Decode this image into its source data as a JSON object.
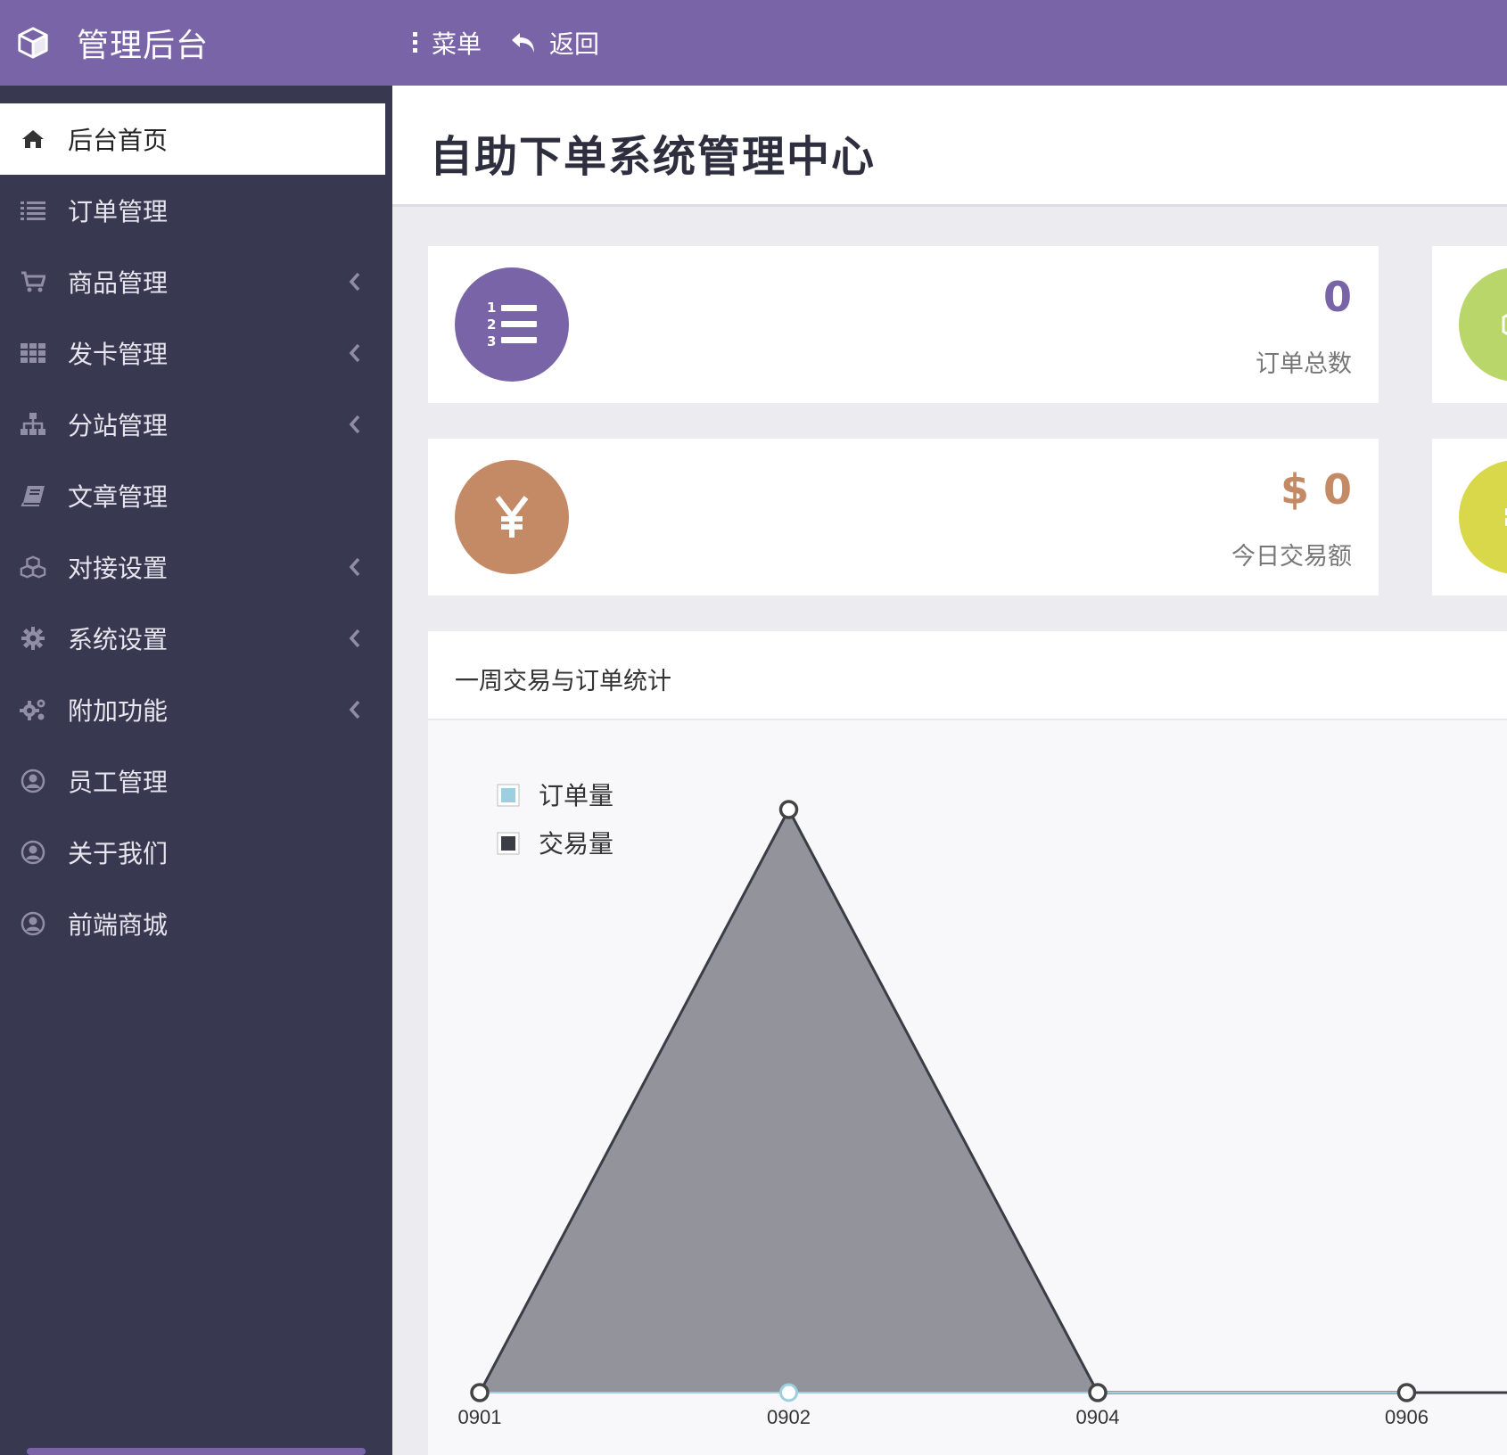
{
  "header": {
    "brand_title": "管理后台",
    "brand_icon": "cube-icon",
    "menu_label": "菜单",
    "back_label": "返回"
  },
  "sidebar": {
    "items": [
      {
        "label": "后台首页",
        "icon": "home-icon",
        "active": true,
        "has_submenu": false
      },
      {
        "label": "订单管理",
        "icon": "list-icon",
        "active": false,
        "has_submenu": false
      },
      {
        "label": "商品管理",
        "icon": "cart-icon",
        "active": false,
        "has_submenu": true
      },
      {
        "label": "发卡管理",
        "icon": "grid-icon",
        "active": false,
        "has_submenu": true
      },
      {
        "label": "分站管理",
        "icon": "sitemap-icon",
        "active": false,
        "has_submenu": true
      },
      {
        "label": "文章管理",
        "icon": "book-icon",
        "active": false,
        "has_submenu": false
      },
      {
        "label": "对接设置",
        "icon": "cubes-icon",
        "active": false,
        "has_submenu": true
      },
      {
        "label": "系统设置",
        "icon": "gear-icon",
        "active": false,
        "has_submenu": true
      },
      {
        "label": "附加功能",
        "icon": "gears-icon",
        "active": false,
        "has_submenu": true
      },
      {
        "label": "员工管理",
        "icon": "user-circle-icon",
        "active": false,
        "has_submenu": false
      },
      {
        "label": "关于我们",
        "icon": "user-circle-icon",
        "active": false,
        "has_submenu": false
      },
      {
        "label": "前端商城",
        "icon": "user-circle-icon",
        "active": false,
        "has_submenu": false
      }
    ]
  },
  "page": {
    "title": "自助下单系统管理中心"
  },
  "stats": [
    {
      "value": "0",
      "label": "订单总数",
      "icon": "ordered-list-icon",
      "color": "#7a64a8"
    },
    {
      "value": "$ 0",
      "label": "今日交易额",
      "icon": "yen-icon",
      "color": "#c48a65"
    }
  ],
  "colors": {
    "topbar": "#7a64a8",
    "sidebar": "#393851",
    "stat_green": "#b9d66b",
    "stat_yellow": "#d9d84a"
  },
  "chart": {
    "title": "一周交易与订单统计"
  },
  "chart_data": {
    "type": "area",
    "x": [
      "0901",
      "0902",
      "0904",
      "0906"
    ],
    "series": [
      {
        "name": "订单量",
        "values": [
          0,
          0,
          0,
          0
        ],
        "color": "#9ccfe0"
      },
      {
        "name": "交易量",
        "values": [
          0,
          1,
          0,
          0
        ],
        "color": "#3c3c46"
      }
    ],
    "legend_position": "top-left",
    "grid": false
  }
}
